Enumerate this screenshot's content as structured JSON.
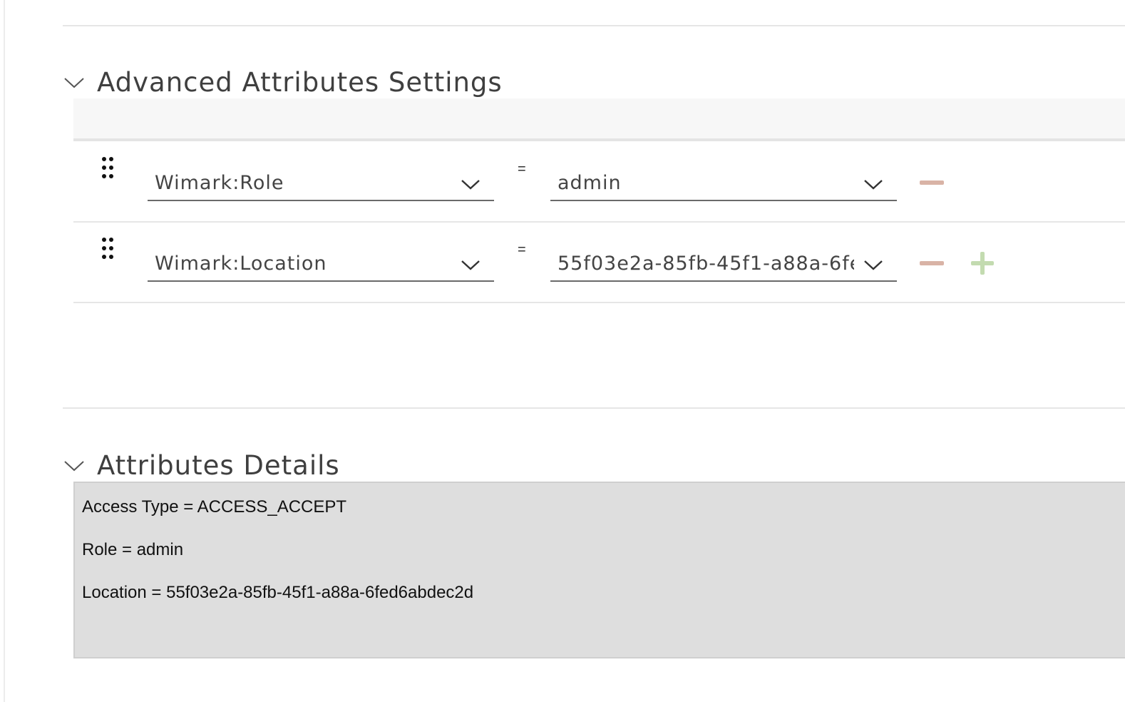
{
  "advanced": {
    "title": "Advanced Attributes Settings",
    "rows": [
      {
        "key": "Wimark:Role",
        "operator": "=",
        "value": "admin",
        "has_add": false
      },
      {
        "key": "Wimark:Location",
        "operator": "=",
        "value": "55f03e2a-85fb-45f1-a88a-6fed6abdec2d",
        "has_add": true
      }
    ]
  },
  "details": {
    "title": "Attributes Details",
    "lines": [
      "Access Type = ACCESS_ACCEPT",
      "Role = admin",
      "Location = 55f03e2a-85fb-45f1-a88a-6fed6abdec2d"
    ]
  },
  "icons": {
    "section_toggle": "chevron-down-icon",
    "dropdown": "chevron-down-icon",
    "drag": "drag-handle-icon",
    "remove": "minus-icon",
    "add": "plus-icon"
  },
  "colors": {
    "remove": "#d9b3a6",
    "add": "#c3dbb0",
    "details_bg": "#dedede"
  }
}
